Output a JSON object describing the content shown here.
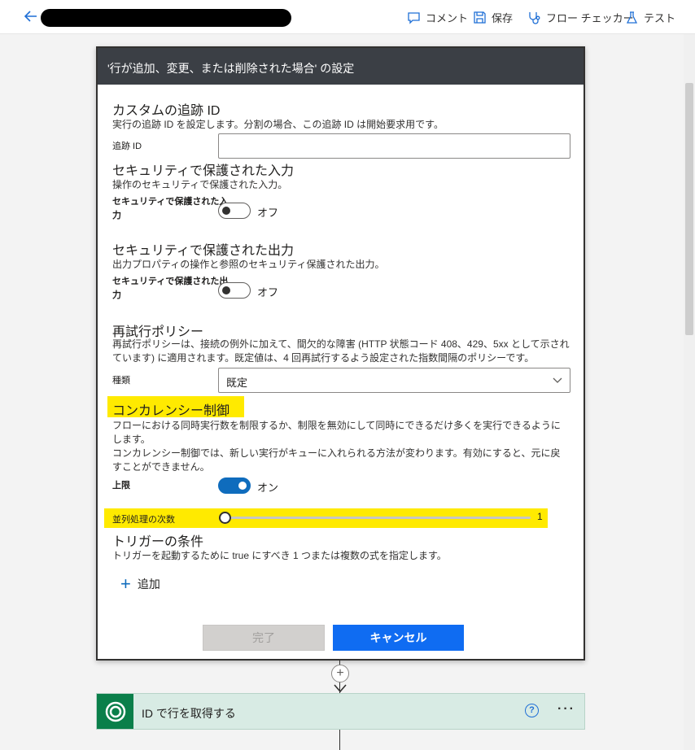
{
  "toolbar": {
    "comment": "コメント",
    "save": "保存",
    "flow_checker": "フロー チェッカー",
    "test": "テスト"
  },
  "dialog": {
    "title": "'行が追加、変更、または削除された場合' の設定",
    "tracking": {
      "title": "カスタムの追跡 ID",
      "desc": "実行の追跡 ID を設定します。分割の場合、この追跡 ID は開始要求用です。",
      "label": "追跡 ID",
      "value": ""
    },
    "secure_input": {
      "title": "セキュリティで保護された入力",
      "desc": "操作のセキュリティで保護された入力。",
      "label_line1": "セキュリティで保護された入",
      "label_line2": "力",
      "state": "オフ"
    },
    "secure_output": {
      "title": "セキュリティで保護された出力",
      "desc": "出力プロパティの操作と参照のセキュリティ保護された出力。",
      "label_line1": "セキュリティで保護された出",
      "label_line2": "力",
      "state": "オフ"
    },
    "retry": {
      "title": "再試行ポリシー",
      "desc_line1": "再試行ポリシーは、接続の例外に加えて、間欠的な障害 (HTTP 状態コード 408、429、5xx として示され",
      "desc_line2": "ています) に適用されます。既定値は、4 回再試行するよう設定された指数間隔のポリシーです。",
      "label": "種類",
      "selected": "既定"
    },
    "concurrency": {
      "title": "コンカレンシー制御",
      "desc_line1": "フローにおける同時実行数を制限するか、制限を無効にして同時にできるだけ多くを実行できるように",
      "desc_line2": "します。",
      "desc_line3": "コンカレンシー制御では、新しい実行がキューに入れられる方法が変わります。有効にすると、元に戻",
      "desc_line4": "すことができません。",
      "limit_label": "上限",
      "limit_state": "オン",
      "parallel_label": "並列処理の次数",
      "parallel_value": "1"
    },
    "trigger_conditions": {
      "title": "トリガーの条件",
      "desc": "トリガーを起動するために true にすべき 1 つまたは複数の式を指定します。",
      "add": "追加"
    },
    "buttons": {
      "done": "完了",
      "cancel": "キャンセル"
    }
  },
  "next_step": {
    "title": "ID で行を取得する",
    "help": "?",
    "more": "···"
  },
  "colors": {
    "accent": "#0f6cbd",
    "highlight": "#ffea00",
    "header_bg": "#3b3f45",
    "card_bg": "#d8ebe4"
  }
}
